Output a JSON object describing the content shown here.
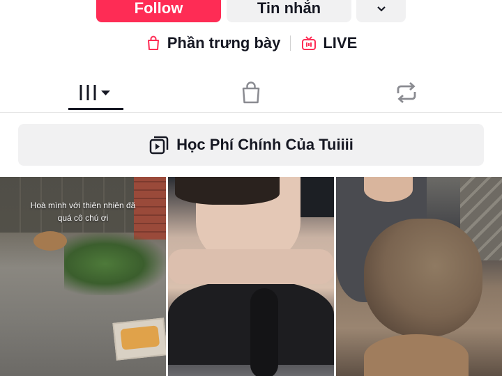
{
  "actions": {
    "follow_label": "Follow",
    "message_label": "Tin nhắn",
    "more_icon": "chevron-down-icon"
  },
  "links": {
    "showcase_label": "Phần trưng bày",
    "showcase_icon": "shopping-bag-icon",
    "live_label": "LIVE",
    "live_icon": "tv-icon"
  },
  "tabs": [
    {
      "name": "videos",
      "icon": "grid-dropdown-icon",
      "active": true
    },
    {
      "name": "shop",
      "icon": "shopping-bag-icon",
      "active": false
    },
    {
      "name": "reposts",
      "icon": "repost-icon",
      "active": false
    }
  ],
  "playlist": {
    "title": "Học Phí Chính Của Tuiiii",
    "icon": "playlist-icon"
  },
  "videos": [
    {
      "caption": "Hoà mình với thiên nhiên đã quá cô chú ơi"
    },
    {
      "caption": ""
    },
    {
      "caption": ""
    }
  ],
  "colors": {
    "accent": "#fe2c55",
    "secondary_button": "#f1f1f2",
    "text": "#161823"
  }
}
